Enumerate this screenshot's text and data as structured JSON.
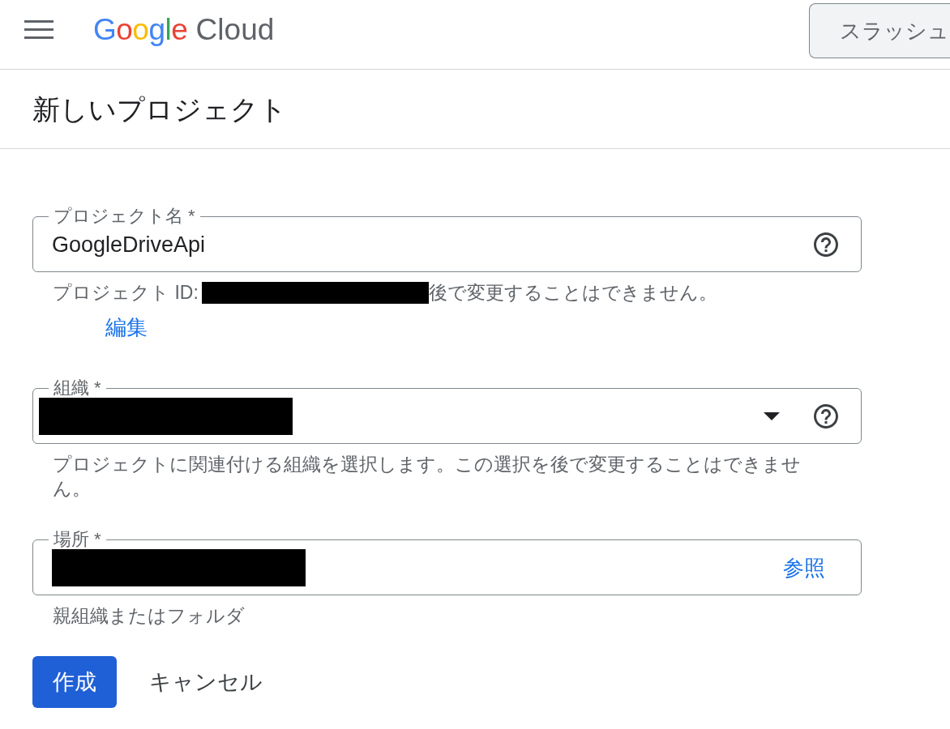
{
  "header": {
    "logo": {
      "brand": "Google",
      "product": "Cloud"
    },
    "search_button": {
      "label": "スラッシュ"
    }
  },
  "page_title": "新しいプロジェクト",
  "form": {
    "fields": [
      {
        "kind": "text",
        "label": "プロジェクト名 *",
        "value": "GoogleDriveApi",
        "redacted": false,
        "project_id": {
          "label": "プロジェクト ID:",
          "redacted": true,
          "note": "後で変更することはできません。",
          "edit_link": "編集"
        }
      },
      {
        "kind": "select",
        "label": "組織 *",
        "redacted": true,
        "helper": "プロジェクトに関連付ける組織を選択します。この選択を後で変更することはできません。"
      },
      {
        "kind": "browse",
        "label": "場所 *",
        "redacted": true,
        "action": "参照",
        "helper": "親組織またはフォルダ"
      }
    ],
    "buttons": [
      {
        "kind": "primary",
        "label": "作成"
      },
      {
        "kind": "text",
        "label": "キャンセル"
      }
    ]
  }
}
